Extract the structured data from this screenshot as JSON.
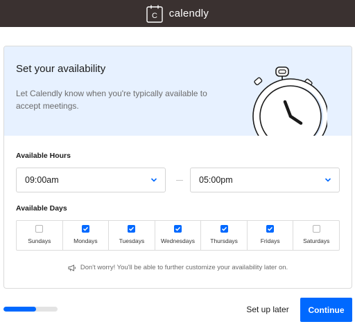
{
  "header": {
    "brand_name": "calendly",
    "logo_icon": "calendar-logo-icon",
    "logo_letter": "C",
    "background": "#3a3130"
  },
  "hero": {
    "title": "Set your availability",
    "description": "Let Calendly know when you're typically available to accept meetings.",
    "illustration": "stopwatch-icon",
    "background": "#e7f1ff"
  },
  "hours": {
    "label": "Available Hours",
    "start": "09:00am",
    "end": "05:00pm"
  },
  "days": {
    "label": "Available Days",
    "items": [
      {
        "label": "Sundays",
        "checked": false
      },
      {
        "label": "Mondays",
        "checked": true
      },
      {
        "label": "Tuesdays",
        "checked": true
      },
      {
        "label": "Wednesdays",
        "checked": true
      },
      {
        "label": "Thursdays",
        "checked": true
      },
      {
        "label": "Fridays",
        "checked": true
      },
      {
        "label": "Saturdays",
        "checked": false
      }
    ]
  },
  "note": {
    "icon": "megaphone-icon",
    "text": "Don't worry! You'll be able to further customize your availability later on."
  },
  "footer": {
    "progress": 0.6,
    "later_label": "Set up later",
    "continue_label": "Continue"
  },
  "colors": {
    "accent": "#0069ff"
  }
}
